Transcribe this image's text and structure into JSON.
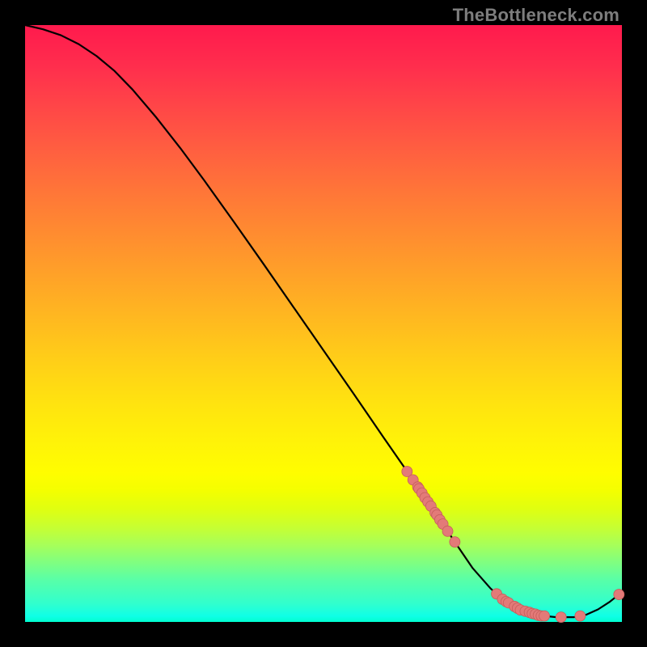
{
  "watermark": "TheBottleneck.com",
  "colors": {
    "line": "#000000",
    "marker_fill": "#e37a78",
    "marker_stroke": "#c65e5c"
  },
  "chart_data": {
    "type": "line",
    "title": "",
    "xlabel": "",
    "ylabel": "",
    "xlim": [
      0,
      100
    ],
    "ylim": [
      0,
      100
    ],
    "series": [
      {
        "name": "curve",
        "x": [
          0,
          3,
          6,
          9,
          12,
          15,
          18,
          22,
          26,
          30,
          35,
          40,
          45,
          50,
          55,
          60,
          65,
          69,
          72,
          75,
          78,
          80,
          83,
          86,
          89,
          92,
          94,
          96,
          98,
          100
        ],
        "y": [
          100,
          99.3,
          98.3,
          96.8,
          94.8,
          92.3,
          89.2,
          84.5,
          79.4,
          74.0,
          67.0,
          59.9,
          52.7,
          45.5,
          38.3,
          31.0,
          23.8,
          17.9,
          13.4,
          9.0,
          5.6,
          3.8,
          2.0,
          1.1,
          0.8,
          0.8,
          1.2,
          2.1,
          3.4,
          5.0
        ]
      }
    ],
    "markers": [
      {
        "x": 64,
        "y": 25.2
      },
      {
        "x": 65,
        "y": 23.8
      },
      {
        "x": 65.8,
        "y": 22.6
      },
      {
        "x": 66,
        "y": 22.3
      },
      {
        "x": 66.5,
        "y": 21.6
      },
      {
        "x": 67,
        "y": 20.8
      },
      {
        "x": 67.5,
        "y": 20.1
      },
      {
        "x": 68,
        "y": 19.4
      },
      {
        "x": 68.7,
        "y": 18.3
      },
      {
        "x": 69,
        "y": 17.9
      },
      {
        "x": 69.5,
        "y": 17.1
      },
      {
        "x": 70,
        "y": 16.4
      },
      {
        "x": 70.8,
        "y": 15.2
      },
      {
        "x": 72,
        "y": 13.4
      },
      {
        "x": 79,
        "y": 4.7
      },
      {
        "x": 80,
        "y": 3.8
      },
      {
        "x": 80.6,
        "y": 3.4
      },
      {
        "x": 81,
        "y": 3.2
      },
      {
        "x": 82,
        "y": 2.6
      },
      {
        "x": 82.5,
        "y": 2.3
      },
      {
        "x": 83,
        "y": 2.0
      },
      {
        "x": 83.8,
        "y": 1.8
      },
      {
        "x": 84.5,
        "y": 1.6
      },
      {
        "x": 85,
        "y": 1.4
      },
      {
        "x": 85.5,
        "y": 1.3
      },
      {
        "x": 86,
        "y": 1.1
      },
      {
        "x": 86.5,
        "y": 1.0
      },
      {
        "x": 87,
        "y": 1.0
      },
      {
        "x": 89.8,
        "y": 0.8
      },
      {
        "x": 93,
        "y": 1.0
      },
      {
        "x": 99.5,
        "y": 4.6
      }
    ]
  }
}
